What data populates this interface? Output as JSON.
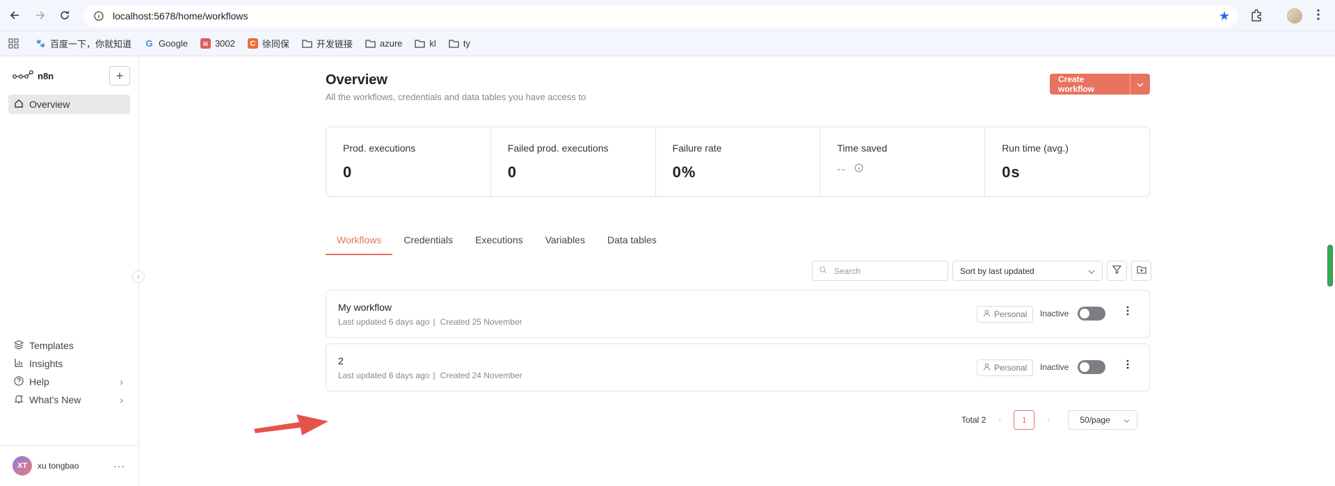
{
  "browser": {
    "url": "localhost:5678/home/workflows",
    "bookmarks": [
      {
        "label": "百度一下，你就知道",
        "icon": "baidu-icon",
        "color": "#3a5fe0"
      },
      {
        "label": "Google",
        "icon": "google-icon",
        "color": "#4285f4"
      },
      {
        "label": "3002",
        "icon": "app-icon",
        "color": "#e05b5b"
      },
      {
        "label": "徐同保",
        "icon": "csdn-icon",
        "color": "#f06c35"
      },
      {
        "label": "开发链接",
        "icon": "folder-icon",
        "color": "#555"
      },
      {
        "label": "azure",
        "icon": "folder-icon",
        "color": "#555"
      },
      {
        "label": "kl",
        "icon": "folder-icon",
        "color": "#555"
      },
      {
        "label": "ty",
        "icon": "folder-icon",
        "color": "#555"
      }
    ]
  },
  "sidebar": {
    "brand": "n8n",
    "overview": "Overview",
    "templates": "Templates",
    "insights": "Insights",
    "help": "Help",
    "whats_new": "What's New",
    "user_initials": "XT",
    "user_name": "xu tongbao"
  },
  "main": {
    "title": "Overview",
    "subtitle": "All the workflows, credentials and data tables you have access to",
    "create_button": "Create workflow",
    "stats": [
      {
        "label": "Prod. executions",
        "value": "0"
      },
      {
        "label": "Failed prod. executions",
        "value": "0"
      },
      {
        "label": "Failure rate",
        "value": "0%"
      },
      {
        "label": "Time saved",
        "value": "--"
      },
      {
        "label": "Run time (avg.)",
        "value": "0s"
      }
    ],
    "tabs": [
      "Workflows",
      "Credentials",
      "Executions",
      "Variables",
      "Data tables"
    ],
    "search_placeholder": "Search",
    "sort_value": "Sort by last updated",
    "workflows": [
      {
        "name": "My workflow",
        "updated": "Last updated 6 days ago",
        "created": "Created 25 November",
        "owner": "Personal",
        "status": "Inactive"
      },
      {
        "name": "2",
        "updated": "Last updated 6 days ago",
        "created": "Created 24 November",
        "owner": "Personal",
        "status": "Inactive"
      }
    ],
    "pagination": {
      "total": "Total 2",
      "page": "1",
      "page_size": "50/page"
    }
  },
  "colors": {
    "accent": "#e8735f",
    "annotation_arrow": "#e5534b"
  }
}
